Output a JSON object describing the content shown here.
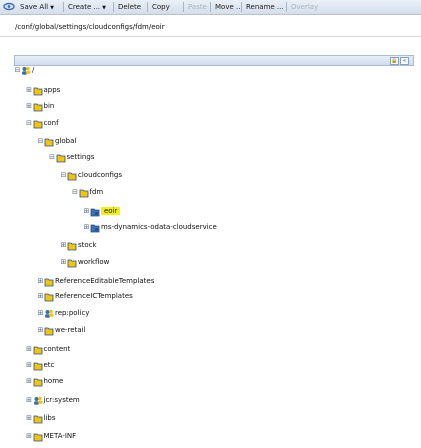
{
  "toolbar": {
    "items": [
      {
        "label": "Save All",
        "has_menu": true,
        "enabled": true
      },
      {
        "label": "Create ...",
        "has_menu": true,
        "enabled": true
      },
      {
        "label": "Delete",
        "has_menu": false,
        "enabled": true
      },
      {
        "label": "Copy",
        "has_menu": false,
        "enabled": true
      },
      {
        "label": "Paste",
        "has_menu": false,
        "enabled": false
      },
      {
        "label": "Move ...",
        "has_menu": false,
        "enabled": true
      },
      {
        "label": "Rename ...",
        "has_menu": false,
        "enabled": true
      },
      {
        "label": "Overlay",
        "has_menu": false,
        "enabled": false
      }
    ]
  },
  "path": "/conf/global/settings/cloudconfigs/fdm/eoir",
  "header_buttons": [
    {
      "icon": "lock-icon",
      "label": "🔒"
    },
    {
      "icon": "collapse-icon",
      "label": "«"
    }
  ],
  "colors": {
    "selection": "#f3ef12",
    "toolbar_bg": "#dfe7f2",
    "folder_yellow": "#f1c40f",
    "folder_blue": "#3d6fb6"
  },
  "tree": [
    {
      "label": "/",
      "level": 0,
      "toggle": "-",
      "icon": "users-icon"
    },
    {
      "label": "apps",
      "level": 1,
      "toggle": "+",
      "icon": "folder-icon"
    },
    {
      "label": "bin",
      "level": 1,
      "toggle": "+",
      "icon": "folder-icon"
    },
    {
      "label": "conf",
      "level": 1,
      "toggle": "-",
      "icon": "folder-icon"
    },
    {
      "label": "global",
      "level": 2,
      "toggle": "-",
      "icon": "folder-icon"
    },
    {
      "label": "settings",
      "level": 3,
      "toggle": "-",
      "icon": "folder-icon"
    },
    {
      "label": "cloudconfigs",
      "level": 4,
      "toggle": "-",
      "icon": "folder-icon"
    },
    {
      "label": "fdm",
      "level": 5,
      "toggle": "-",
      "icon": "folder-icon"
    },
    {
      "label": "eoir",
      "level": 6,
      "toggle": "+",
      "icon": "gear-folder-icon",
      "selected": true
    },
    {
      "label": "ms-dynamics-odata-cloudservice",
      "level": 6,
      "toggle": "+",
      "icon": "gear-folder-icon"
    },
    {
      "label": "stock",
      "level": 4,
      "toggle": "+",
      "icon": "folder-icon"
    },
    {
      "label": "workflow",
      "level": 4,
      "toggle": "+",
      "icon": "folder-icon"
    },
    {
      "label": "ReferenceEditableTemplates",
      "level": 2,
      "toggle": "+",
      "icon": "folder-icon"
    },
    {
      "label": "ReferenceICTemplates",
      "level": 2,
      "toggle": "+",
      "icon": "folder-icon"
    },
    {
      "label": "rep:policy",
      "level": 2,
      "toggle": "+",
      "icon": "users-icon"
    },
    {
      "label": "we-retail",
      "level": 2,
      "toggle": "+",
      "icon": "folder-icon"
    },
    {
      "label": "content",
      "level": 1,
      "toggle": "+",
      "icon": "folder-icon"
    },
    {
      "label": "etc",
      "level": 1,
      "toggle": "+",
      "icon": "folder-icon"
    },
    {
      "label": "home",
      "level": 1,
      "toggle": "+",
      "icon": "folder-icon"
    },
    {
      "label": "jcr:system",
      "level": 1,
      "toggle": "+",
      "icon": "users-icon"
    },
    {
      "label": "libs",
      "level": 1,
      "toggle": "+",
      "icon": "folder-icon"
    },
    {
      "label": "META-INF",
      "level": 1,
      "toggle": "+",
      "icon": "folder-icon"
    }
  ]
}
